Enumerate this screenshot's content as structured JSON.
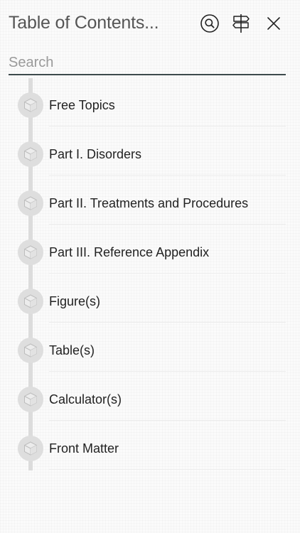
{
  "header": {
    "title": "Table of Contents...",
    "search_icon": "search-icon",
    "signpost_icon": "signpost-icon",
    "close_icon": "close-icon"
  },
  "search": {
    "placeholder": "Search",
    "value": ""
  },
  "toc": {
    "items": [
      {
        "label": "Free Topics",
        "icon": "cube-icon"
      },
      {
        "label": "Part I. Disorders",
        "icon": "cube-icon"
      },
      {
        "label": "Part II. Treatments and Procedures",
        "icon": "cube-icon"
      },
      {
        "label": "Part III. Reference Appendix",
        "icon": "cube-icon"
      },
      {
        "label": "Figure(s)",
        "icon": "cube-icon"
      },
      {
        "label": "Table(s)",
        "icon": "cube-icon"
      },
      {
        "label": "Calculator(s)",
        "icon": "cube-icon"
      },
      {
        "label": "Front Matter",
        "icon": "cube-icon"
      }
    ]
  },
  "colors": {
    "background": "#fbfbfb",
    "title_text": "#555555",
    "item_text": "#222222",
    "search_underline": "#3d4a4c",
    "timeline": "#dcdcdc",
    "node": "#dedede"
  }
}
